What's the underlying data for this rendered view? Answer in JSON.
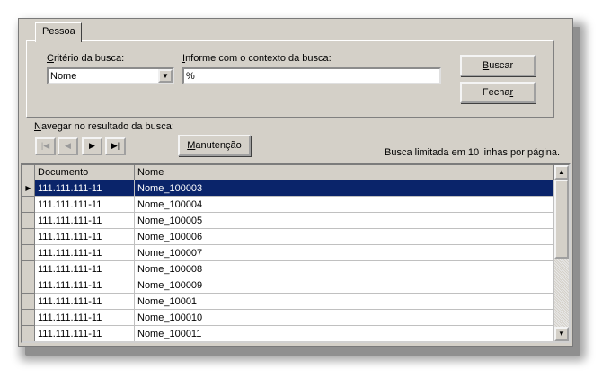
{
  "tab": {
    "label": "Pessoa"
  },
  "criterio": {
    "label": "Critério da busca:",
    "value": "Nome"
  },
  "contexto": {
    "label": "Informe com o contexto da busca:",
    "value": "%"
  },
  "buttons": {
    "buscar": "Buscar",
    "fechar": "Fechar",
    "manutencao": "Manutenção"
  },
  "nav": {
    "label": "Navegar no resultado da busca:",
    "first": "|◀",
    "prev": "◀",
    "next": "▶",
    "last": "▶|"
  },
  "limit_text": "Busca limitada em 10 linhas por página.",
  "grid": {
    "columns": [
      "Documento",
      "Nome"
    ],
    "rows": [
      [
        "111.111.111-11",
        "Nome_100003"
      ],
      [
        "111.111.111-11",
        "Nome_100004"
      ],
      [
        "111.111.111-11",
        "Nome_100005"
      ],
      [
        "111.111.111-11",
        "Nome_100006"
      ],
      [
        "111.111.111-11",
        "Nome_100007"
      ],
      [
        "111.111.111-11",
        "Nome_100008"
      ],
      [
        "111.111.111-11",
        "Nome_100009"
      ],
      [
        "111.111.111-11",
        "Nome_10001"
      ],
      [
        "111.111.111-11",
        "Nome_100010"
      ],
      [
        "111.111.111-11",
        "Nome_100011"
      ]
    ],
    "selected_row": 0
  },
  "icons": {
    "dropdown": "chevron-down-icon",
    "row_indicator": "row-pointer-icon",
    "scroll_up": "scroll-up-icon",
    "scroll_down": "scroll-down-icon"
  },
  "colors": {
    "selection": "#0a246a",
    "face": "#d4d0c8"
  }
}
